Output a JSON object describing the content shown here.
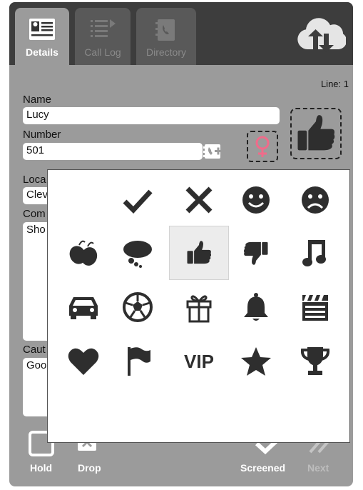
{
  "tabs": [
    {
      "label": "Details",
      "active": true
    },
    {
      "label": "Call Log",
      "active": false
    },
    {
      "label": "Directory",
      "active": false
    }
  ],
  "line_label": "Line: 1",
  "form": {
    "name_label": "Name",
    "name_value": "Lucy",
    "number_label": "Number",
    "number_value": "501",
    "location_label": "Loca",
    "location_value": "Clev",
    "comment_label": "Com",
    "comment_value": "Sho",
    "caution_label": "Caut",
    "caution_value": "Goo"
  },
  "bottom": {
    "hold": "Hold",
    "drop": "Drop",
    "screened": "Screened",
    "next": "Next"
  },
  "icon_picker": {
    "selected": "thumbs-up",
    "rows": [
      [
        "blank",
        "check",
        "cross",
        "smile",
        "frown"
      ],
      [
        "boxing-gloves",
        "thought-cloud",
        "thumbs-up",
        "thumbs-down",
        "music-note"
      ],
      [
        "car",
        "soccer-ball",
        "gift",
        "bell",
        "clapperboard"
      ],
      [
        "heart",
        "flag",
        "vip",
        "star",
        "trophy"
      ]
    ],
    "vip_text": "VIP"
  },
  "colors": {
    "panel": "#9b9b9b",
    "topbar": "#3d3d3d",
    "icon": "#2e2e2e",
    "female": "#f06b8a"
  }
}
